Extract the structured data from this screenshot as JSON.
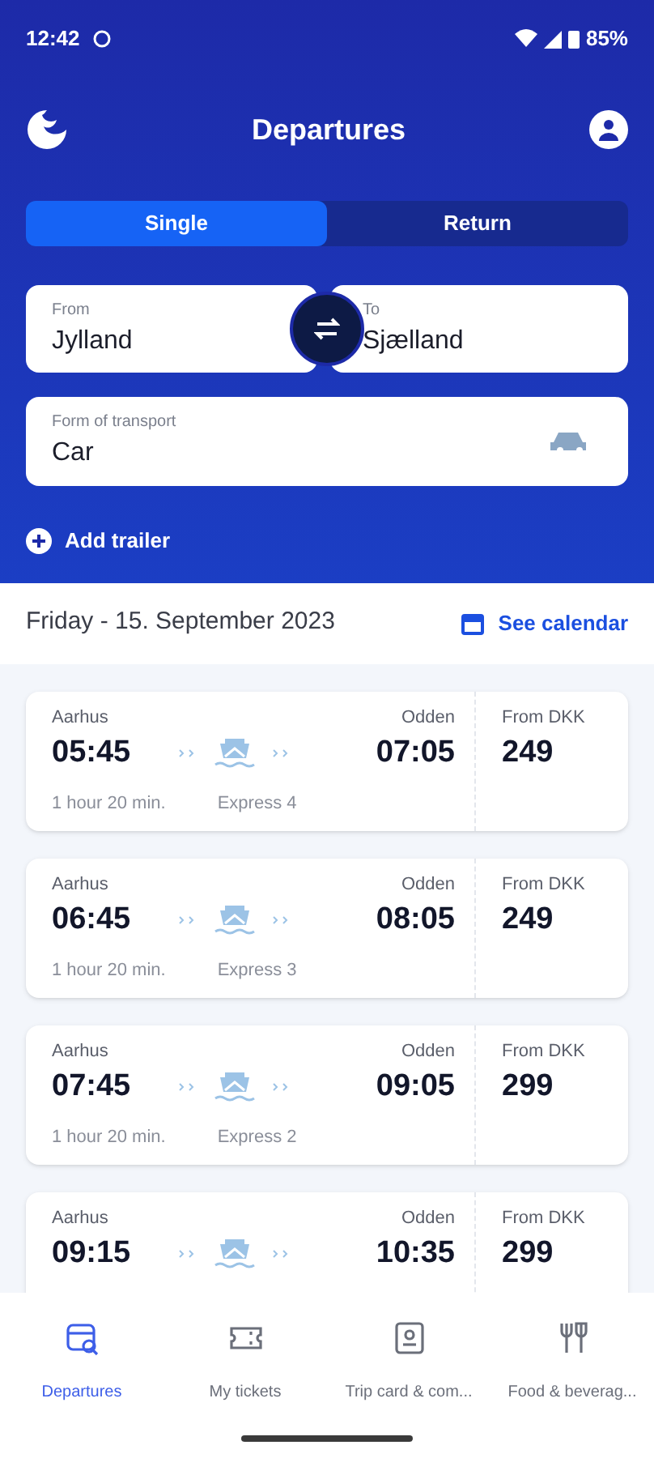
{
  "status_bar": {
    "time": "12:42",
    "battery": "85%"
  },
  "header": {
    "title": "Departures"
  },
  "trip_type_tabs": [
    {
      "label": "Single",
      "selected": true
    },
    {
      "label": "Return",
      "selected": false
    }
  ],
  "route": {
    "from": {
      "label": "From",
      "value": "Jylland"
    },
    "to": {
      "label": "To",
      "value": "Sjælland"
    }
  },
  "transport": {
    "label": "Form of transport",
    "value": "Car"
  },
  "add_trailer": "Add trailer",
  "date_bar": {
    "date": "Friday - 15. September 2023",
    "calendar_link": "See calendar"
  },
  "departures": [
    {
      "from": "Aarhus",
      "depart": "05:45",
      "to": "Odden",
      "arrive": "07:05",
      "duration": "1 hour 20 min.",
      "vessel": "Express 4",
      "price_label": "From DKK",
      "price": "249"
    },
    {
      "from": "Aarhus",
      "depart": "06:45",
      "to": "Odden",
      "arrive": "08:05",
      "duration": "1 hour 20 min.",
      "vessel": "Express 3",
      "price_label": "From DKK",
      "price": "249"
    },
    {
      "from": "Aarhus",
      "depart": "07:45",
      "to": "Odden",
      "arrive": "09:05",
      "duration": "1 hour 20 min.",
      "vessel": "Express 2",
      "price_label": "From DKK",
      "price": "299"
    },
    {
      "from": "Aarhus",
      "depart": "09:15",
      "to": "Odden",
      "arrive": "10:35",
      "price_label": "From DKK",
      "price": "299"
    }
  ],
  "bottom_nav": [
    {
      "label": "Departures",
      "kind": "departures",
      "selected": true
    },
    {
      "label": "My tickets",
      "kind": "tickets",
      "selected": false
    },
    {
      "label": "Trip card & com...",
      "kind": "card",
      "selected": false
    },
    {
      "label": "Food & beverag...",
      "kind": "food",
      "selected": false
    }
  ]
}
